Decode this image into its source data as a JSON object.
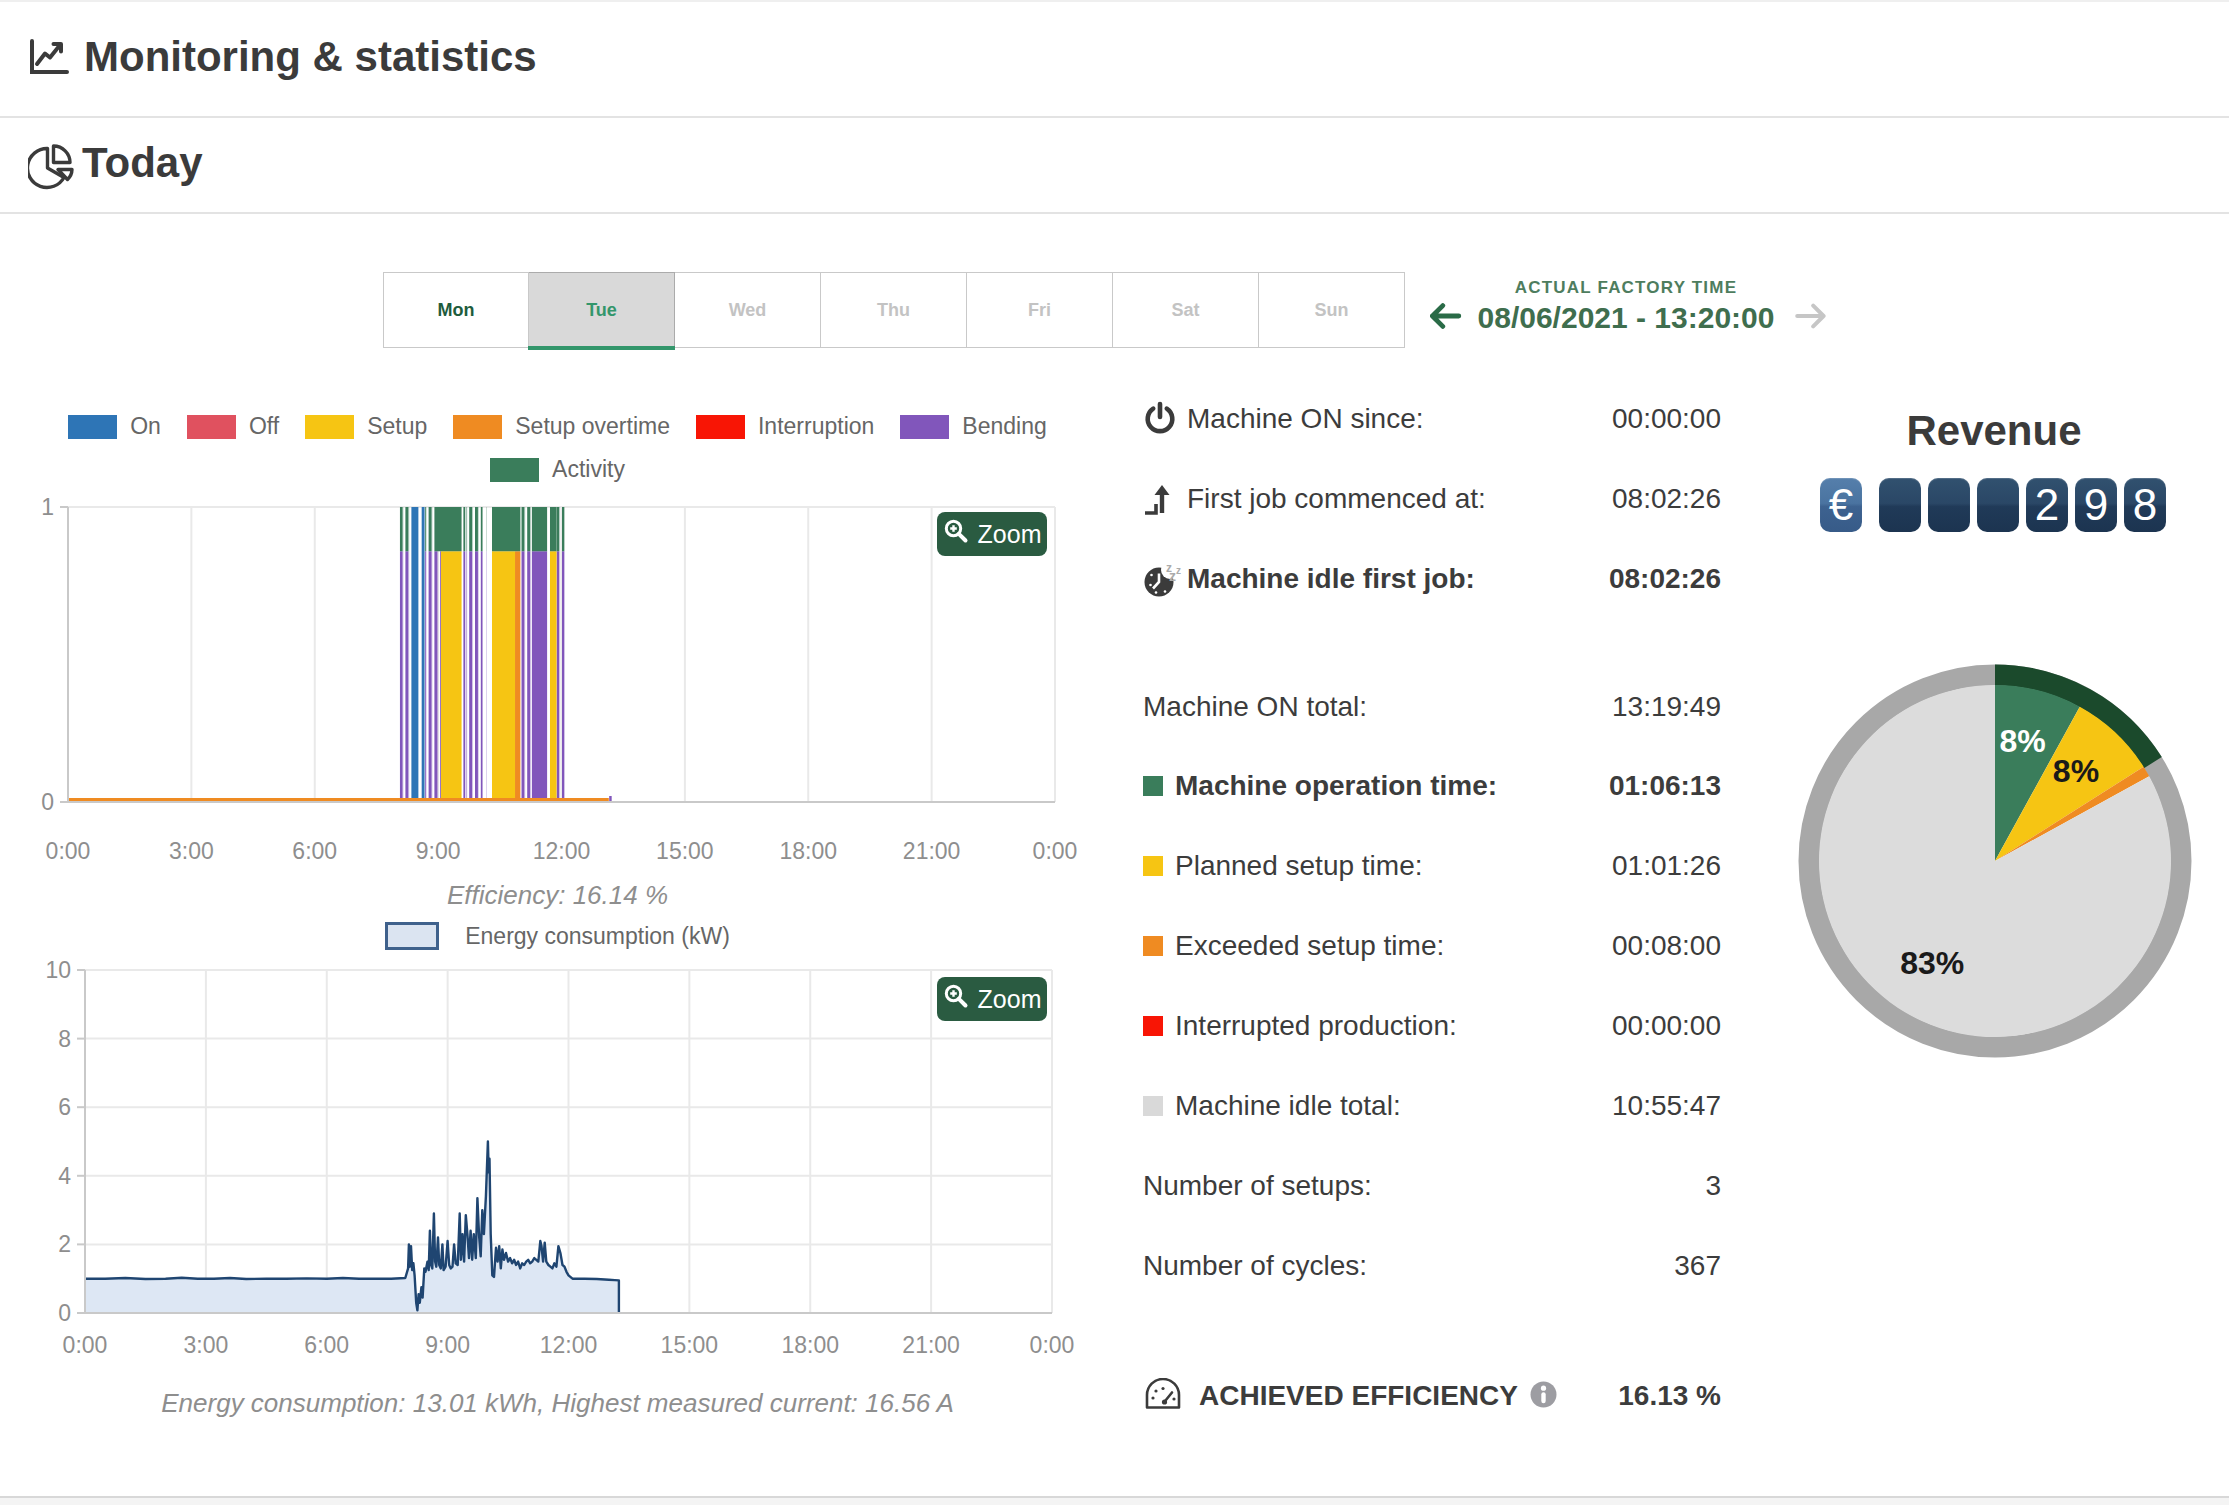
{
  "header": {
    "title": "Monitoring & statistics"
  },
  "section": {
    "title": "Today"
  },
  "tabs": {
    "days": [
      {
        "label": "Mon",
        "state": "past"
      },
      {
        "label": "Tue",
        "state": "selected"
      },
      {
        "label": "Wed",
        "state": "future"
      },
      {
        "label": "Thu",
        "state": "future"
      },
      {
        "label": "Fri",
        "state": "future"
      },
      {
        "label": "Sat",
        "state": "future"
      },
      {
        "label": "Sun",
        "state": "future"
      }
    ]
  },
  "factory_time": {
    "label": "ACTUAL FACTORY TIME",
    "value": "08/06/2021 - 13:20:00"
  },
  "zoom_button_label": "Zoom",
  "colors": {
    "on": "#2e75b6",
    "off": "#e0515f",
    "setup": "#f6c513",
    "setup_overtime": "#ef8b22",
    "interruption": "#f81505",
    "bending": "#8156bb",
    "activity": "#3a7d5b",
    "idle": "#d9d9d9",
    "energy_line": "#1f4571",
    "energy_fill": "#dde7f4",
    "pie_ring": "#a8a8a8",
    "pie_ring_done": "#1b4a2c",
    "grid": "#e9e9e9",
    "axis": "#c9c9c9",
    "tick_text": "#8e8e8e",
    "accent_green": "#33966b"
  },
  "stats": {
    "rows": [
      {
        "icon": "power-icon",
        "label": "Machine ON since:",
        "value": "00:00:00",
        "bold": false,
        "y": 399
      },
      {
        "icon": "first-job-icon",
        "label": "First job commenced at:",
        "value": "08:02:26",
        "bold": false,
        "y": 479
      },
      {
        "icon": "idle-clock-icon",
        "label": "Machine idle first job:",
        "value": "08:02:26",
        "bold": true,
        "y": 559
      },
      {
        "icon": null,
        "label": "Machine ON total:",
        "value": "13:19:49",
        "bold": false,
        "y": 687
      },
      {
        "swatch": "#3a7d5b",
        "label": "Machine operation time:",
        "value": "01:06:13",
        "bold": true,
        "y": 766
      },
      {
        "swatch": "#f6c513",
        "label": "Planned setup time:",
        "value": "01:01:26",
        "bold": false,
        "y": 846
      },
      {
        "swatch": "#ef8b22",
        "label": "Exceeded setup time:",
        "value": "00:08:00",
        "bold": false,
        "y": 926
      },
      {
        "swatch": "#f81505",
        "label": "Interrupted production:",
        "value": "00:00:00",
        "bold": false,
        "y": 1006
      },
      {
        "swatch": "#d9d9d9",
        "label": "Machine idle total:",
        "value": "10:55:47",
        "bold": false,
        "y": 1086
      },
      {
        "icon": null,
        "label": "Number of setups:",
        "value": "3",
        "bold": false,
        "y": 1166
      },
      {
        "icon": null,
        "label": "Number of cycles:",
        "value": "367",
        "bold": false,
        "y": 1246
      }
    ],
    "efficiency": {
      "label": "ACHIEVED EFFICIENCY",
      "value": "16.13 %"
    }
  },
  "revenue": {
    "title": "Revenue",
    "currency": "€",
    "tiles": [
      "",
      "",
      "",
      "2",
      "9",
      "8"
    ]
  },
  "chart_data": [
    {
      "type": "bar",
      "name": "machine-state-timeline",
      "xlabel": "",
      "ylabel": "",
      "ylim": [
        0,
        1
      ],
      "xlim_hours": [
        0,
        24
      ],
      "x_ticks": [
        "0:00",
        "3:00",
        "6:00",
        "9:00",
        "12:00",
        "15:00",
        "18:00",
        "21:00",
        "0:00"
      ],
      "y_ticks": [
        "1",
        "0"
      ],
      "caption": "Efficiency: 16.14 %",
      "legend_row1": [
        {
          "label": "On",
          "color": "#2e75b6"
        },
        {
          "label": "Off",
          "color": "#e0515f"
        },
        {
          "label": "Setup",
          "color": "#f6c513"
        },
        {
          "label": "Setup overtime",
          "color": "#ef8b22"
        },
        {
          "label": "Interruption",
          "color": "#f81505"
        },
        {
          "label": "Bending",
          "color": "#8156bb"
        }
      ],
      "legend_row2": [
        {
          "label": "Activity",
          "color": "#3a7d5b"
        }
      ],
      "state_band": [
        0,
        0.85
      ],
      "activity_band": [
        0.85,
        1.0
      ],
      "series": {
        "on_full_height": [
          [
            8.35,
            8.52
          ],
          [
            8.6,
            8.67
          ]
        ],
        "bending_solid": [
          [
            11.28,
            11.65
          ]
        ],
        "bending_striped": [
          [
            8.07,
            8.33
          ],
          [
            8.68,
            9.07
          ],
          [
            9.59,
            9.66
          ],
          [
            9.68,
            10.08
          ],
          [
            10.14,
            10.18
          ],
          [
            11.02,
            11.28
          ],
          [
            11.88,
            12.07
          ]
        ],
        "setup_solid": [
          [
            9.07,
            9.57
          ],
          [
            10.31,
            10.87
          ],
          [
            11.72,
            11.88
          ]
        ],
        "setup_overtime_solid": [
          [
            10.87,
            11.0
          ]
        ],
        "setup_overtime_baseline": [
          0,
          13.15
        ],
        "bending_baseline_tick": [
          13.16,
          13.22
        ],
        "activity_solid": [
          [
            8.92,
            9.57
          ],
          [
            10.31,
            11.0
          ],
          [
            11.28,
            11.65
          ],
          [
            11.72,
            11.88
          ]
        ],
        "activity_striped": [
          [
            8.07,
            8.33
          ],
          [
            8.68,
            8.92
          ],
          [
            9.59,
            9.66
          ],
          [
            9.68,
            10.08
          ],
          [
            10.14,
            10.18
          ],
          [
            11.02,
            11.28
          ],
          [
            11.88,
            12.07
          ]
        ]
      }
    },
    {
      "type": "area",
      "name": "energy-consumption",
      "series_label": "Energy consumption (kW)",
      "ylim": [
        0,
        10
      ],
      "xlim_hours": [
        0,
        24
      ],
      "x_ticks": [
        "0:00",
        "3:00",
        "6:00",
        "9:00",
        "12:00",
        "15:00",
        "18:00",
        "21:00",
        "0:00"
      ],
      "y_ticks": [
        0,
        2,
        4,
        6,
        8,
        10
      ],
      "caption": "Energy consumption: 13.01 kWh, Highest measured current: 16.56 A",
      "points": [
        [
          0,
          1.0
        ],
        [
          0.5,
          1.0
        ],
        [
          1.0,
          1.02
        ],
        [
          1.5,
          0.99
        ],
        [
          2.0,
          1.0
        ],
        [
          2.4,
          1.03
        ],
        [
          2.8,
          1.0
        ],
        [
          3.2,
          1.0
        ],
        [
          3.6,
          1.02
        ],
        [
          4.0,
          0.99
        ],
        [
          4.5,
          1.0
        ],
        [
          5.0,
          1.0
        ],
        [
          5.5,
          1.01
        ],
        [
          6.0,
          1.0
        ],
        [
          6.4,
          1.02
        ],
        [
          6.8,
          1.0
        ],
        [
          7.2,
          1.0
        ],
        [
          7.6,
          1.0
        ],
        [
          7.95,
          1.02
        ],
        [
          8.02,
          1.3
        ],
        [
          8.04,
          2.0
        ],
        [
          8.06,
          1.35
        ],
        [
          8.09,
          1.95
        ],
        [
          8.12,
          1.25
        ],
        [
          8.15,
          1.45
        ],
        [
          8.18,
          1.1
        ],
        [
          8.22,
          0.3
        ],
        [
          8.25,
          0.08
        ],
        [
          8.28,
          0.55
        ],
        [
          8.31,
          0.3
        ],
        [
          8.35,
          0.75
        ],
        [
          8.38,
          0.45
        ],
        [
          8.42,
          1.3
        ],
        [
          8.45,
          1.2
        ],
        [
          8.5,
          1.5
        ],
        [
          8.53,
          1.25
        ],
        [
          8.56,
          2.4
        ],
        [
          8.59,
          1.4
        ],
        [
          8.62,
          1.3
        ],
        [
          8.66,
          2.9
        ],
        [
          8.69,
          1.5
        ],
        [
          8.72,
          1.35
        ],
        [
          8.76,
          2.2
        ],
        [
          8.79,
          1.4
        ],
        [
          8.83,
          1.3
        ],
        [
          8.87,
          2.0
        ],
        [
          8.9,
          1.25
        ],
        [
          8.95,
          1.35
        ],
        [
          9.0,
          2.1
        ],
        [
          9.04,
          1.4
        ],
        [
          9.08,
          1.3
        ],
        [
          9.12,
          1.35
        ],
        [
          9.16,
          2.0
        ],
        [
          9.2,
          1.45
        ],
        [
          9.25,
          1.4
        ],
        [
          9.3,
          2.9
        ],
        [
          9.33,
          1.55
        ],
        [
          9.37,
          2.3
        ],
        [
          9.41,
          1.5
        ],
        [
          9.45,
          2.85
        ],
        [
          9.49,
          2.3
        ],
        [
          9.53,
          1.6
        ],
        [
          9.57,
          2.4
        ],
        [
          9.61,
          1.55
        ],
        [
          9.65,
          2.3
        ],
        [
          9.7,
          1.6
        ],
        [
          9.74,
          3.35
        ],
        [
          9.78,
          2.25
        ],
        [
          9.82,
          1.65
        ],
        [
          9.86,
          3.0
        ],
        [
          9.9,
          2.3
        ],
        [
          9.95,
          3.4
        ],
        [
          10.0,
          5.0
        ],
        [
          10.02,
          4.1
        ],
        [
          10.04,
          4.5
        ],
        [
          10.07,
          2.3
        ],
        [
          10.11,
          1.1
        ],
        [
          10.15,
          1.05
        ],
        [
          10.2,
          1.9
        ],
        [
          10.24,
          1.5
        ],
        [
          10.28,
          1.95
        ],
        [
          10.32,
          1.3
        ],
        [
          10.36,
          1.85
        ],
        [
          10.4,
          1.55
        ],
        [
          10.45,
          1.75
        ],
        [
          10.5,
          1.5
        ],
        [
          10.55,
          1.6
        ],
        [
          10.6,
          1.45
        ],
        [
          10.65,
          1.55
        ],
        [
          10.7,
          1.4
        ],
        [
          10.75,
          1.5
        ],
        [
          10.8,
          1.3
        ],
        [
          10.85,
          1.45
        ],
        [
          10.9,
          1.4
        ],
        [
          10.95,
          1.5
        ],
        [
          11.0,
          1.55
        ],
        [
          11.05,
          1.45
        ],
        [
          11.1,
          1.5
        ],
        [
          11.15,
          1.6
        ],
        [
          11.2,
          1.55
        ],
        [
          11.25,
          1.5
        ],
        [
          11.3,
          2.1
        ],
        [
          11.33,
          1.95
        ],
        [
          11.37,
          1.5
        ],
        [
          11.41,
          2.05
        ],
        [
          11.45,
          1.5
        ],
        [
          11.5,
          1.4
        ],
        [
          11.55,
          1.35
        ],
        [
          11.6,
          1.3
        ],
        [
          11.65,
          1.45
        ],
        [
          11.7,
          1.35
        ],
        [
          11.75,
          1.95
        ],
        [
          11.8,
          1.75
        ],
        [
          11.85,
          1.4
        ],
        [
          11.9,
          1.35
        ],
        [
          11.95,
          1.2
        ],
        [
          12.0,
          1.1
        ],
        [
          12.1,
          1.0
        ],
        [
          12.4,
          1.0
        ],
        [
          12.7,
          0.99
        ],
        [
          13.0,
          0.97
        ],
        [
          13.15,
          0.96
        ],
        [
          13.25,
          0.95
        ]
      ]
    },
    {
      "type": "pie",
      "name": "time-distribution",
      "slices": [
        {
          "label": "8%",
          "value": 8,
          "color": "#3a7d5b",
          "label_color": "#ffffff",
          "label_angle": 13,
          "label_r": 123
        },
        {
          "label": "8%",
          "value": 8,
          "color": "#f6c513",
          "label_color": "#1a1a1a",
          "label_angle": 42,
          "label_r": 121
        },
        {
          "label": "",
          "value": 1,
          "color": "#ef8b22"
        },
        {
          "label": "83%",
          "value": 83,
          "color": "#dcdcdc",
          "label_color": "#1a1a1a",
          "label_angle": 211.5,
          "label_r": 120
        }
      ],
      "ring": {
        "value_pct": 16.13,
        "color": "#1b4a2c",
        "track_color": "#a8a8a8"
      }
    }
  ]
}
